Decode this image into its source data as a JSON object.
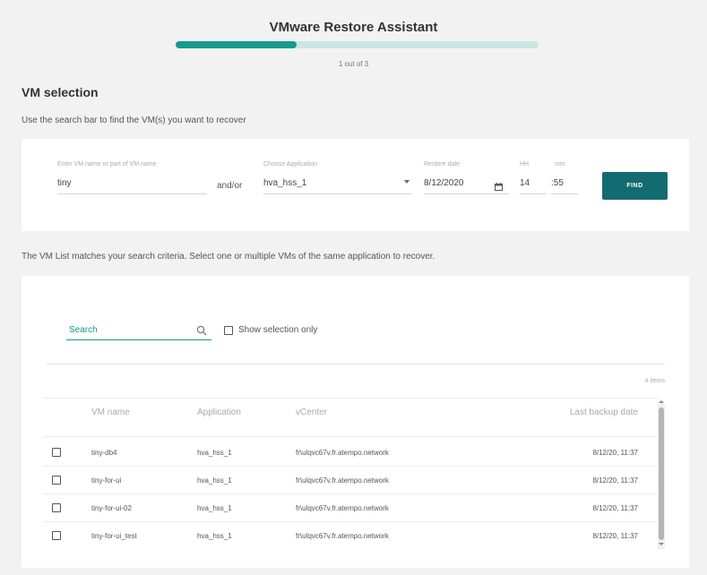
{
  "wizard": {
    "title": "VMware Restore Assistant",
    "progress_fraction": 0.333,
    "step_text": "1 out of 3"
  },
  "section_title": "VM selection",
  "instructions": "Use the search bar to find the VM(s) you want to recover",
  "search_form": {
    "vm_name_label": "Enter VM name or part of VM name",
    "vm_name_value": "tiny",
    "andor": "and/or",
    "application_label": "Choose Application",
    "application_value": "hva_hss_1",
    "restore_date_label": "Restore date",
    "restore_date_value": "8/12/2020",
    "hour_label": "HH",
    "hour_value": "14",
    "minute_label": "mm",
    "minute_value": ":55",
    "find_label": "FIND"
  },
  "results_description": "The VM List matches your search criteria. Select one or multiple VMs of the same application to recover.",
  "results": {
    "search_placeholder": "Search",
    "show_selection_label": "Show selection only",
    "items_count": "4 items",
    "columns": [
      "VM name",
      "Application",
      "vCenter",
      "Last backup date"
    ],
    "rows": [
      {
        "vm_name": "tiny-db4",
        "application": "hva_hss_1",
        "vcenter": "fr\\ulqvc67v.fr.atempo.network",
        "last_backup": "8/12/20, 11:37"
      },
      {
        "vm_name": "tiny-for-ui",
        "application": "hva_hss_1",
        "vcenter": "fr\\ulqvc67v.fr.atempo.network",
        "last_backup": "8/12/20, 11:37"
      },
      {
        "vm_name": "tiny-for-ui-02",
        "application": "hva_hss_1",
        "vcenter": "fr\\ulqvc67v.fr.atempo.network",
        "last_backup": "8/12/20, 11:37"
      },
      {
        "vm_name": "tiny-for-ui_test",
        "application": "hva_hss_1",
        "vcenter": "fr\\ulqvc67v.fr.atempo.network",
        "last_backup": "8/12/20, 11:37"
      }
    ]
  },
  "colors": {
    "accent": "#149b8d",
    "button": "#126b70",
    "progress_track": "#c9e6e4"
  }
}
